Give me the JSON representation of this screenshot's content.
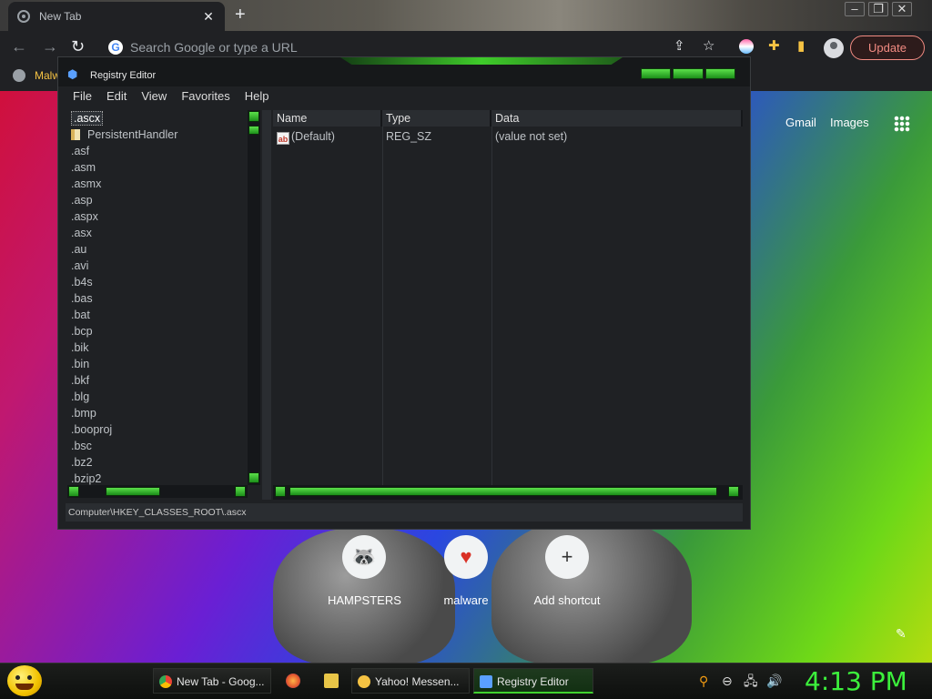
{
  "browser": {
    "tab_title": "New Tab",
    "tab_close": "✕",
    "new_tab": "+",
    "omnibox_placeholder": "Search Google or type a URL",
    "update_label": "Update",
    "bookmark_label": "Malw",
    "ntp": {
      "gmail": "Gmail",
      "images": "Images",
      "shortcuts": [
        {
          "label": "HAMPSTERS",
          "icon": "raccoon-icon"
        },
        {
          "label": "malware",
          "icon": "heart-icon"
        },
        {
          "label": "Add shortcut",
          "icon": "plus-icon"
        }
      ]
    }
  },
  "regedit": {
    "title": "Registry Editor",
    "menu": [
      "File",
      "Edit",
      "View",
      "Favorites",
      "Help"
    ],
    "tree_items": [
      ".ascx",
      "PersistentHandler",
      ".asf",
      ".asm",
      ".asmx",
      ".asp",
      ".aspx",
      ".asx",
      ".au",
      ".avi",
      ".b4s",
      ".bas",
      ".bat",
      ".bcp",
      ".bik",
      ".bin",
      ".bkf",
      ".blg",
      ".bmp",
      ".booproj",
      ".bsc",
      ".bz2",
      ".bzip2"
    ],
    "columns": [
      "Name",
      "Type",
      "Data"
    ],
    "values": [
      {
        "name": "(Default)",
        "type": "REG_SZ",
        "data": "(value not set)"
      }
    ],
    "status_path": "Computer\\HKEY_CLASSES_ROOT\\.ascx",
    "accent": "#3fcc2a"
  },
  "taskbar": {
    "tasks": [
      {
        "label": "New Tab - Goog...",
        "icon": "chrome-icon"
      },
      {
        "label": "Yahoo! Messen...",
        "icon": "yahoo-messenger-icon"
      },
      {
        "label": "Registry Editor",
        "icon": "regedit-icon"
      }
    ],
    "clock": "4:13 PM",
    "clock_color": "#3cf03c"
  }
}
